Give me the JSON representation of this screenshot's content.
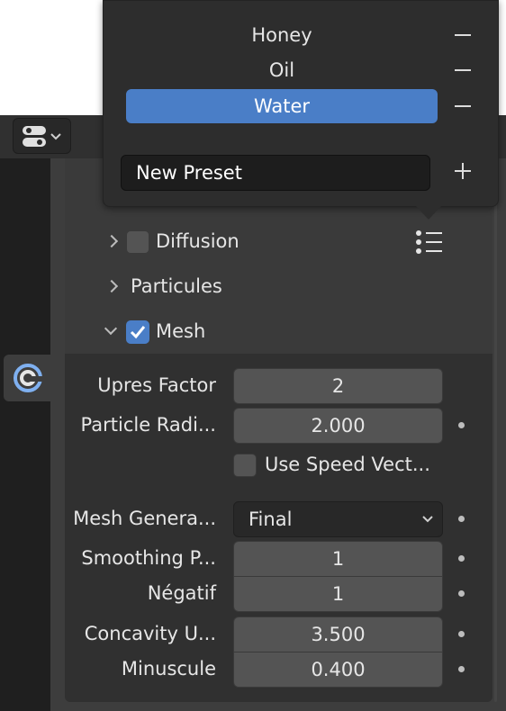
{
  "popup": {
    "presets": [
      {
        "label": "Honey",
        "active": false
      },
      {
        "label": "Oil",
        "active": false
      },
      {
        "label": "Water",
        "active": true
      }
    ],
    "new_preset_value": "New Preset"
  },
  "panel": {
    "subpanels": [
      {
        "label": "Diffusion",
        "expanded": false,
        "checkbox": true,
        "checked": false
      },
      {
        "label": "Particules",
        "expanded": false,
        "checkbox": false
      },
      {
        "label": "Mesh",
        "expanded": true,
        "checkbox": true,
        "checked": true
      }
    ],
    "mesh": {
      "upres_factor_label": "Upres Factor",
      "upres_factor_value": "2",
      "particle_radius_label": "Particle Radi...",
      "particle_radius_value": "2.000",
      "use_speed_vectors_label": "Use Speed Vect...",
      "use_speed_vectors_checked": false,
      "mesh_generator_label": "Mesh Genera...",
      "mesh_generator_value": "Final",
      "smoothing_positive_label": "Smoothing P...",
      "smoothing_positive_value": "1",
      "negatif_label": "Négatif",
      "negatif_value": "1",
      "concavity_upper_label": "Concavity U...",
      "concavity_upper_value": "3.500",
      "minuscule_label": "Minuscule",
      "minuscule_value": "0.400"
    }
  },
  "icons": {
    "editor_type": "editor-type-icon",
    "physics_tab": "physics-tab-icon",
    "preset_menu": "preset-list-icon"
  },
  "colors": {
    "accent": "#4a7ec7",
    "panel_bg": "#303030",
    "field_bg": "#545454"
  }
}
